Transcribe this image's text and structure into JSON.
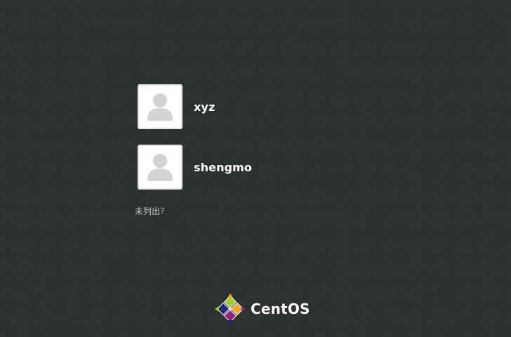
{
  "users": [
    {
      "name": "xyz",
      "icon": "user-avatar-icon"
    },
    {
      "name": "shengmo",
      "icon": "user-avatar-icon"
    }
  ],
  "not_listed_label": "未列出？",
  "brand": {
    "name": "CentOS",
    "icon": "centos-logo-icon"
  },
  "colors": {
    "background": "#2e3132",
    "avatar_border": "#e4e4e4",
    "avatar_silhouette": "#d3d3d3",
    "logo_yellow": "#efa724",
    "logo_green": "#9ccd2a",
    "logo_blue": "#262577",
    "logo_purple": "#932279"
  }
}
